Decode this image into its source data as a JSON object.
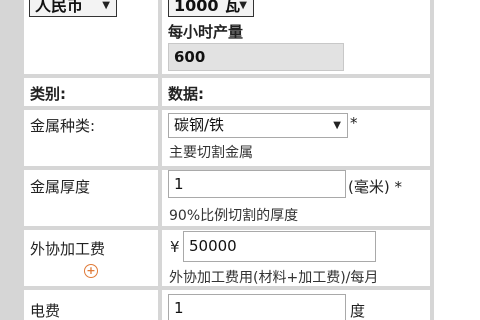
{
  "top_row": {
    "currency_select": "人民币",
    "power_select": "1000 瓦",
    "production_label": "每小时产量",
    "production_value": "600"
  },
  "header": {
    "category": "类别:",
    "data": "数据:"
  },
  "rows": {
    "metal_type": {
      "label": "金属种类:",
      "value": "碳钢/铁",
      "required_mark": "*",
      "hint": "主要切割金属"
    },
    "thickness": {
      "label": "金属厚度",
      "value": "1",
      "unit": "(毫米) *",
      "hint": "90%比例切割的厚度"
    },
    "outsourcing": {
      "label": "外协加工费",
      "currency": "¥",
      "value": "50000",
      "hint": "外协加工费用(材料+加工费)/每月"
    },
    "electricity": {
      "label": "电费",
      "value": "1",
      "unit": "度"
    }
  },
  "icons": {
    "dropdown": "caret-down",
    "add": "plus-circle"
  },
  "colors": {
    "accent": "#e07b39",
    "grid": "#d6d6d6"
  }
}
